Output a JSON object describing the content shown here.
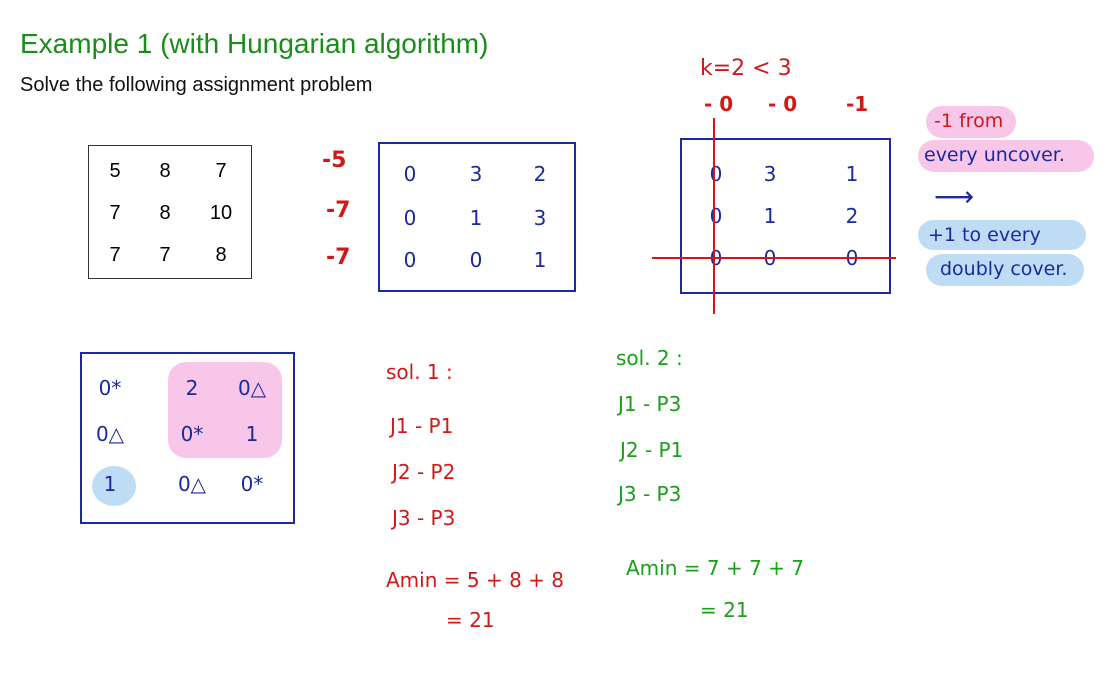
{
  "title": "Example 1 (with Hungarian algorithm)",
  "subtitle": "Solve the following assignment problem",
  "matrix": [
    [
      "5",
      "8",
      "7"
    ],
    [
      "7",
      "8",
      "10"
    ],
    [
      "7",
      "7",
      "8"
    ]
  ],
  "step1": {
    "row_subtract": [
      "-5",
      "-7",
      "-7"
    ],
    "matrix": [
      [
        "0",
        "3",
        "2"
      ],
      [
        "0",
        "1",
        "3"
      ],
      [
        "0",
        "0",
        "1"
      ]
    ]
  },
  "step2": {
    "k_label": "k=2 < 3",
    "col_subtract": [
      "- 0",
      "- 0",
      "-1"
    ],
    "matrix": [
      [
        "0",
        "3",
        "1"
      ],
      [
        "0",
        "1",
        "2"
      ],
      [
        "0",
        "0",
        "0"
      ]
    ]
  },
  "notes": {
    "uncover_line1": "-1 from",
    "uncover_line2": "every uncover.",
    "arrow": "⟶",
    "cover_line1": "+1 to every",
    "cover_line2": "doubly cover."
  },
  "final": {
    "cells": [
      [
        "0*",
        "2",
        "0△"
      ],
      [
        "0△",
        "0*",
        "1"
      ],
      [
        "1",
        "0△",
        "0*"
      ]
    ]
  },
  "sol1": {
    "label": "sol. 1 :",
    "lines": [
      "J1 - P1",
      "J2 - P2",
      "J3 - P3"
    ],
    "amin": "Amin = 5 + 8 + 8",
    "result": "= 21"
  },
  "sol2": {
    "label": "sol. 2 :",
    "lines": [
      "J1 - P3",
      "J2 - P1",
      "J3 - P3"
    ],
    "amin": "Amin = 7 + 7 + 7",
    "result": "= 21"
  }
}
